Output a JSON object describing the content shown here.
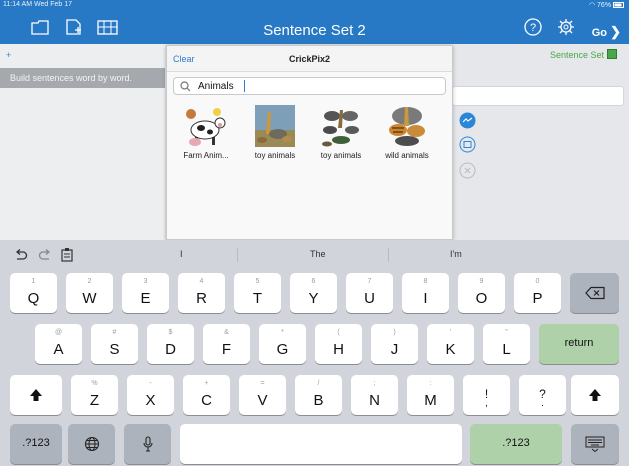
{
  "status_bar": {
    "time_date": "11:14 AM  Wed Feb 17",
    "battery": "76%"
  },
  "nav": {
    "title": "Sentence Set 2",
    "go_label": "Go"
  },
  "app": {
    "plus": "+",
    "hint": "Build sentences word by word.",
    "sentence_set_label": "Sentence Set"
  },
  "popover": {
    "clear_label": "Clear",
    "title": "CrickPix2",
    "search_value": "Animals",
    "results": [
      {
        "label": "Farm Anim...",
        "icon": "farm-animals-thumbnail"
      },
      {
        "label": "toy animals",
        "icon": "toy-animals-thumbnail"
      },
      {
        "label": "toy animals",
        "icon": "toy-animals-2-thumbnail"
      },
      {
        "label": "wild animals",
        "icon": "wild-animals-thumbnail"
      }
    ]
  },
  "keyboard": {
    "suggestions": [
      "I",
      "The",
      "I'm"
    ],
    "row1": [
      {
        "l": "Q",
        "s": "1"
      },
      {
        "l": "W",
        "s": "2"
      },
      {
        "l": "E",
        "s": "3"
      },
      {
        "l": "R",
        "s": "4"
      },
      {
        "l": "T",
        "s": "5"
      },
      {
        "l": "Y",
        "s": "6"
      },
      {
        "l": "U",
        "s": "7"
      },
      {
        "l": "I",
        "s": "8"
      },
      {
        "l": "O",
        "s": "9"
      },
      {
        "l": "P",
        "s": "0"
      }
    ],
    "row2": [
      {
        "l": "A",
        "s": "@"
      },
      {
        "l": "S",
        "s": "#"
      },
      {
        "l": "D",
        "s": "$"
      },
      {
        "l": "F",
        "s": "&"
      },
      {
        "l": "G",
        "s": "*"
      },
      {
        "l": "H",
        "s": "("
      },
      {
        "l": "J",
        "s": ")"
      },
      {
        "l": "K",
        "s": "'"
      },
      {
        "l": "L",
        "s": "\""
      }
    ],
    "row3": [
      {
        "l": "Z",
        "s": "%"
      },
      {
        "l": "X",
        "s": "-"
      },
      {
        "l": "C",
        "s": "+"
      },
      {
        "l": "V",
        "s": "="
      },
      {
        "l": "B",
        "s": "/"
      },
      {
        "l": "N",
        "s": ";"
      },
      {
        "l": "M",
        "s": ":"
      },
      {
        "l": "!",
        "s": ","
      },
      {
        "l": "?",
        "s": "."
      }
    ],
    "return_label": "return",
    "numbers_label": ".?123"
  },
  "colors": {
    "nav_blue": "#2879c5",
    "accent_green": "#4aa84a",
    "return_green": "#aed1a9"
  }
}
